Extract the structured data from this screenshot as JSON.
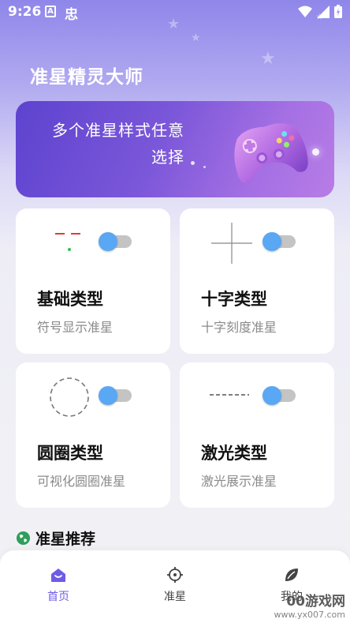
{
  "status_bar": {
    "time": "9:26",
    "icon_a": "A",
    "icon_b": "忠"
  },
  "app": {
    "title": "准星精灵大师"
  },
  "banner": {
    "text": "多个准星样式任意选择"
  },
  "cards": [
    {
      "title": "基础类型",
      "subtitle": "符号显示准星",
      "toggle_on": true
    },
    {
      "title": "十字类型",
      "subtitle": "十字刻度准星",
      "toggle_on": true
    },
    {
      "title": "圆圈类型",
      "subtitle": "可视化圆圈准星",
      "toggle_on": true
    },
    {
      "title": "激光类型",
      "subtitle": "激光展示准星",
      "toggle_on": true
    }
  ],
  "section": {
    "title": "准星推荐"
  },
  "nav": {
    "items": [
      {
        "label": "首页",
        "icon": "home-icon",
        "active": true
      },
      {
        "label": "准星",
        "icon": "crosshair-icon",
        "active": false
      },
      {
        "label": "我的",
        "icon": "leaf-icon",
        "active": false
      }
    ]
  },
  "watermark": {
    "top": "00游戏网",
    "bottom": "www.yx007.com"
  },
  "colors": {
    "accent": "#6c5ce7",
    "toggle_thumb": "#5aa7f4",
    "toggle_track": "#c4c4c4",
    "section_icon": "#2e9e5b"
  }
}
